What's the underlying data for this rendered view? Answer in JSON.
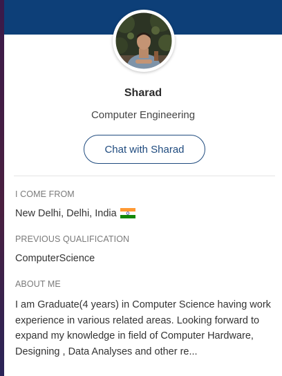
{
  "profile": {
    "name": "Sharad",
    "department": "Computer Engineering",
    "chat_label": "Chat with Sharad"
  },
  "details": {
    "from_label": "I COME FROM",
    "from_value": "New Delhi, Delhi, India",
    "qualification_label": "PREVIOUS QUALIFICATION",
    "qualification_value": "ComputerScience",
    "about_label": "ABOUT ME",
    "about_value": "I am Graduate(4 years) in Computer Science having work experience in various related areas. Looking forward to expand my knowledge in field of Computer Hardware, Designing , Data Analyses and other re..."
  },
  "icons": {
    "flag": "india-flag-icon",
    "avatar": "profile-photo"
  },
  "colors": {
    "banner": "#0d3f78",
    "accent": "#1e4a7e",
    "label": "#7a7a7a",
    "text": "#333333"
  }
}
